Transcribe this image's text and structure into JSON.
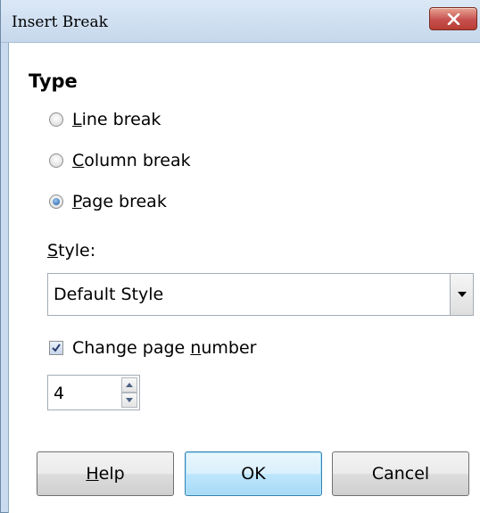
{
  "window": {
    "title": "Insert Break"
  },
  "type_section": {
    "heading": "Type",
    "options": [
      {
        "pre": "",
        "mnemonic": "L",
        "post": "ine break",
        "checked": false
      },
      {
        "pre": "",
        "mnemonic": "C",
        "post": "olumn break",
        "checked": false
      },
      {
        "pre": "",
        "mnemonic": "P",
        "post": "age break",
        "checked": true
      }
    ]
  },
  "style": {
    "label_pre": "",
    "label_mnemonic": "S",
    "label_post": "tyle:",
    "selected": "Default Style"
  },
  "page_number": {
    "checked": true,
    "label_pre": "Change page ",
    "label_mnemonic": "n",
    "label_post": "umber",
    "value": "4"
  },
  "buttons": {
    "help_mnemonic": "H",
    "help_post": "elp",
    "ok": "OK",
    "cancel": "Cancel"
  },
  "colors": {
    "titlebar": "#c6d8ec",
    "close_button": "#c75050",
    "ok_button_border": "#3c7fb1"
  },
  "icons": {
    "close": "close-x-icon",
    "dropdown": "chevron-down-icon",
    "spin_up": "arrow-up-icon",
    "spin_down": "arrow-down-icon",
    "check": "checkmark-icon"
  }
}
